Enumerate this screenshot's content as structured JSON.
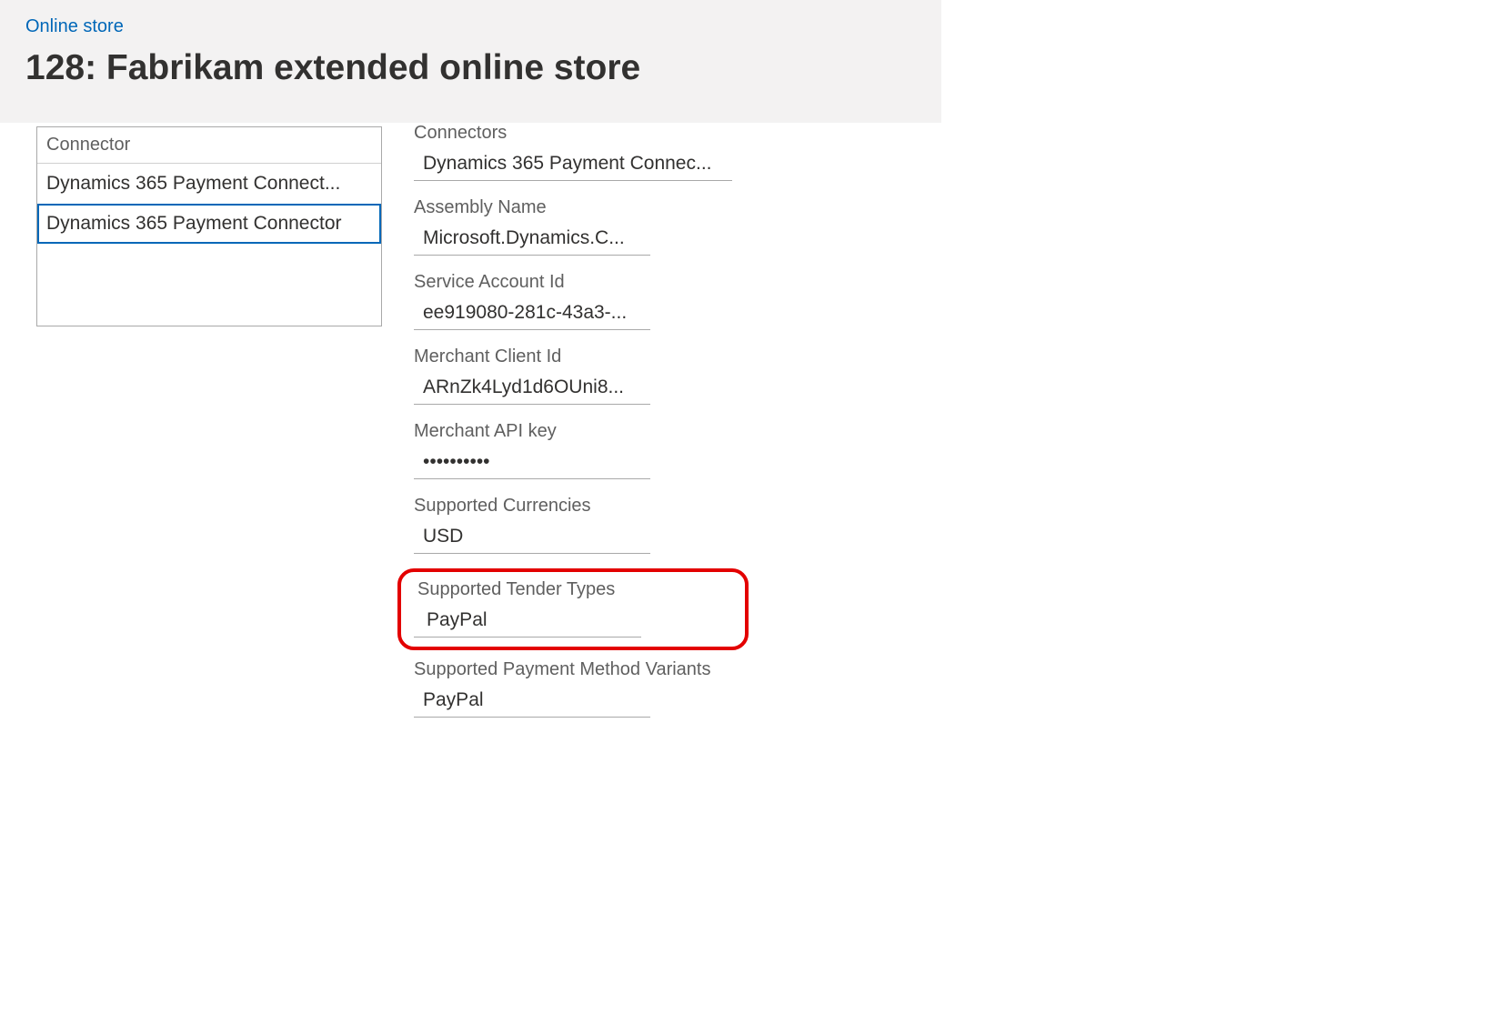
{
  "breadcrumb": {
    "label": "Online store"
  },
  "page": {
    "title": "128: Fabrikam extended online store"
  },
  "connectorList": {
    "header": "Connector",
    "items": [
      {
        "label": "Dynamics 365 Payment Connect..."
      },
      {
        "label": "Dynamics 365 Payment Connector"
      }
    ]
  },
  "details": {
    "connectors": {
      "label": "Connectors",
      "value": "Dynamics 365 Payment Connec..."
    },
    "assemblyName": {
      "label": "Assembly Name",
      "value": "Microsoft.Dynamics.C..."
    },
    "serviceAccountId": {
      "label": "Service Account Id",
      "value": "ee919080-281c-43a3-..."
    },
    "merchantClientId": {
      "label": "Merchant Client Id",
      "value": "ARnZk4Lyd1d6OUni8..."
    },
    "merchantApiKey": {
      "label": "Merchant API key",
      "value": "••••••••••"
    },
    "supportedCurrencies": {
      "label": "Supported Currencies",
      "value": "USD"
    },
    "supportedTenderTypes": {
      "label": "Supported Tender Types",
      "value": "PayPal"
    },
    "supportedPaymentMethodVariants": {
      "label": "Supported Payment Method Variants",
      "value": "PayPal"
    }
  }
}
